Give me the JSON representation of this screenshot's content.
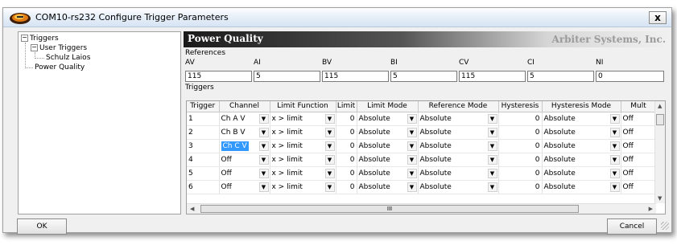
{
  "window": {
    "title": "COM10-rs232 Configure Trigger Parameters",
    "close_label": "x"
  },
  "tree": {
    "root": "Triggers",
    "user_triggers": "User Triggers",
    "user_child": "Schulz Laios",
    "power_quality": "Power Quality"
  },
  "panel": {
    "title": "Power Quality",
    "brand": "Arbiter Systems, Inc."
  },
  "references": {
    "label": "References",
    "fields": [
      {
        "label": "AV",
        "value": "115"
      },
      {
        "label": "AI",
        "value": "5"
      },
      {
        "label": "BV",
        "value": "115"
      },
      {
        "label": "BI",
        "value": "5"
      },
      {
        "label": "CV",
        "value": "115"
      },
      {
        "label": "CI",
        "value": "5"
      },
      {
        "label": "NI",
        "value": "0"
      }
    ]
  },
  "triggers": {
    "label": "Triggers",
    "columns": [
      "Trigger",
      "Channel",
      "Limit Function",
      "Limit",
      "Limit Mode",
      "Reference Mode",
      "Hysteresis",
      "Hysteresis Mode",
      "Mult"
    ],
    "rows": [
      {
        "trigger": "1",
        "channel": "Ch A V",
        "function": "x > limit",
        "limit": "0",
        "limit_mode": "Absolute",
        "ref_mode": "Absolute",
        "hysteresis": "0",
        "hyst_mode": "Absolute",
        "mult": "Off"
      },
      {
        "trigger": "2",
        "channel": "Ch B V",
        "function": "x > limit",
        "limit": "0",
        "limit_mode": "Absolute",
        "ref_mode": "Absolute",
        "hysteresis": "0",
        "hyst_mode": "Absolute",
        "mult": "Off"
      },
      {
        "trigger": "3",
        "channel": "Ch C V",
        "function": "x > limit",
        "limit": "0",
        "limit_mode": "Absolute",
        "ref_mode": "Absolute",
        "hysteresis": "0",
        "hyst_mode": "Absolute",
        "mult": "Off"
      },
      {
        "trigger": "4",
        "channel": "Off",
        "function": "x > limit",
        "limit": "0",
        "limit_mode": "Absolute",
        "ref_mode": "Absolute",
        "hysteresis": "0",
        "hyst_mode": "Absolute",
        "mult": "Off"
      },
      {
        "trigger": "5",
        "channel": "Off",
        "function": "x > limit",
        "limit": "0",
        "limit_mode": "Absolute",
        "ref_mode": "Absolute",
        "hysteresis": "0",
        "hyst_mode": "Absolute",
        "mult": "Off"
      },
      {
        "trigger": "6",
        "channel": "Off",
        "function": "x > limit",
        "limit": "0",
        "limit_mode": "Absolute",
        "ref_mode": "Absolute",
        "hysteresis": "0",
        "hyst_mode": "Absolute",
        "mult": "Off"
      }
    ]
  },
  "buttons": {
    "ok": "OK",
    "cancel": "Cancel"
  },
  "scroll": {
    "thumb_grip": "III"
  },
  "colors": {
    "selection": "#3399ff",
    "title_bar": "#dbe6f4"
  }
}
